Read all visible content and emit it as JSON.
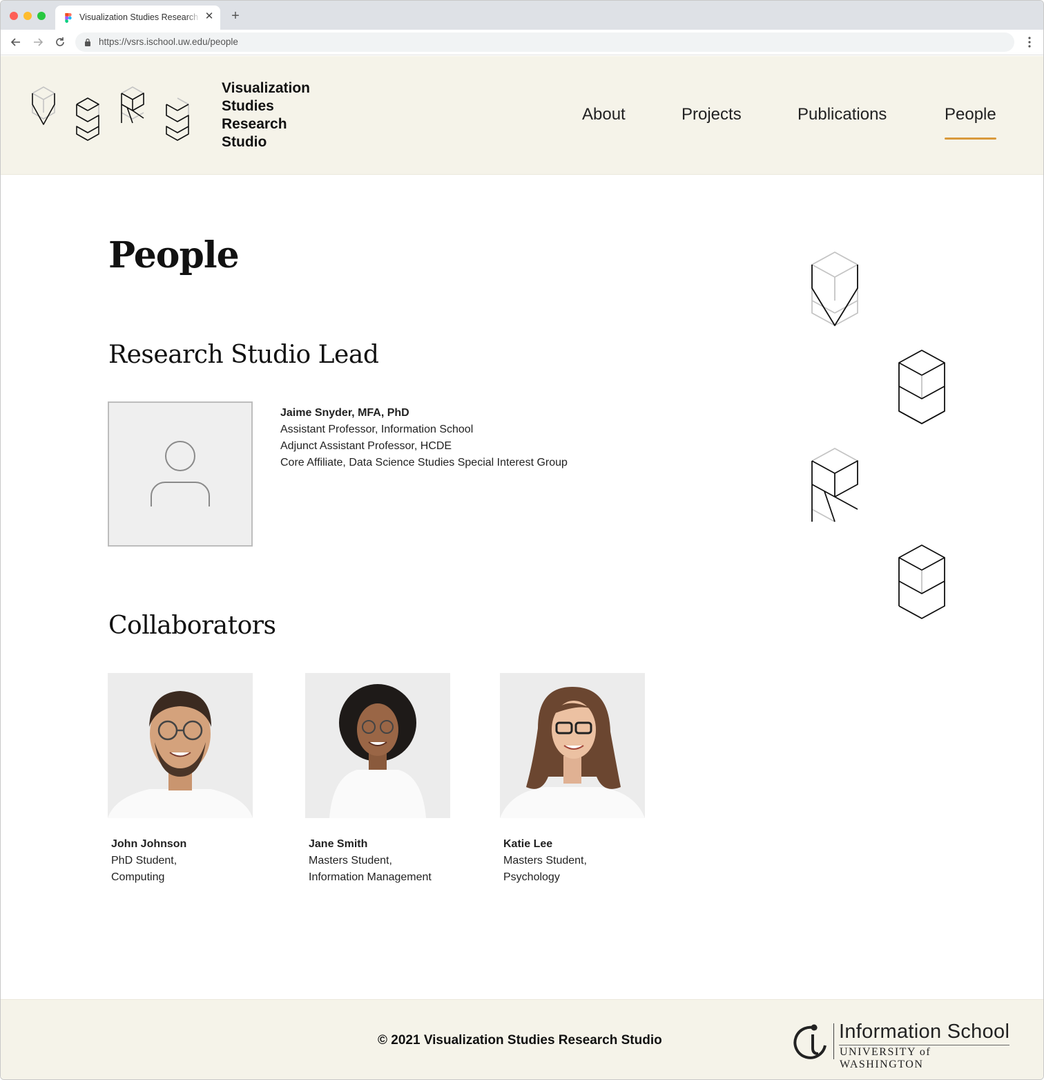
{
  "browser": {
    "tab_title": "Visualization Studies Research Studio",
    "url": "https://vsrs.ischool.uw.edu/people"
  },
  "site": {
    "logo_text": [
      "Visualization",
      "Studies",
      "Research",
      "Studio"
    ],
    "nav": [
      "About",
      "Projects",
      "Publications",
      "People"
    ],
    "active_nav": "People",
    "accent_color": "#d99a3c",
    "header_bg": "#f5f3e9"
  },
  "main": {
    "title": "People",
    "lead_section": {
      "heading": "Research Studio Lead",
      "person": {
        "name": "Jaime Snyder, MFA, PhD",
        "roles": [
          "Assistant Professor, Information School",
          "Adjunct Assistant Professor, HCDE",
          "Core Affiliate, Data Science Studies Special Interest Group"
        ],
        "photo_icon": "user-placeholder-icon"
      }
    },
    "collaborators_section": {
      "heading": "Collaborators",
      "people": [
        {
          "name": "John Johnson",
          "line1": "PhD Student,",
          "line2": "Computing"
        },
        {
          "name": "Jane Smith",
          "line1": "Masters Student,",
          "line2": "Information Management"
        },
        {
          "name": "Katie Lee",
          "line1": "Masters Student,",
          "line2": "Psychology"
        }
      ]
    }
  },
  "footer": {
    "copyright": "© 2021 Visualization Studies Research Studio",
    "ischool_name": "Information School",
    "university": "UNIVERSITY of WASHINGTON"
  }
}
